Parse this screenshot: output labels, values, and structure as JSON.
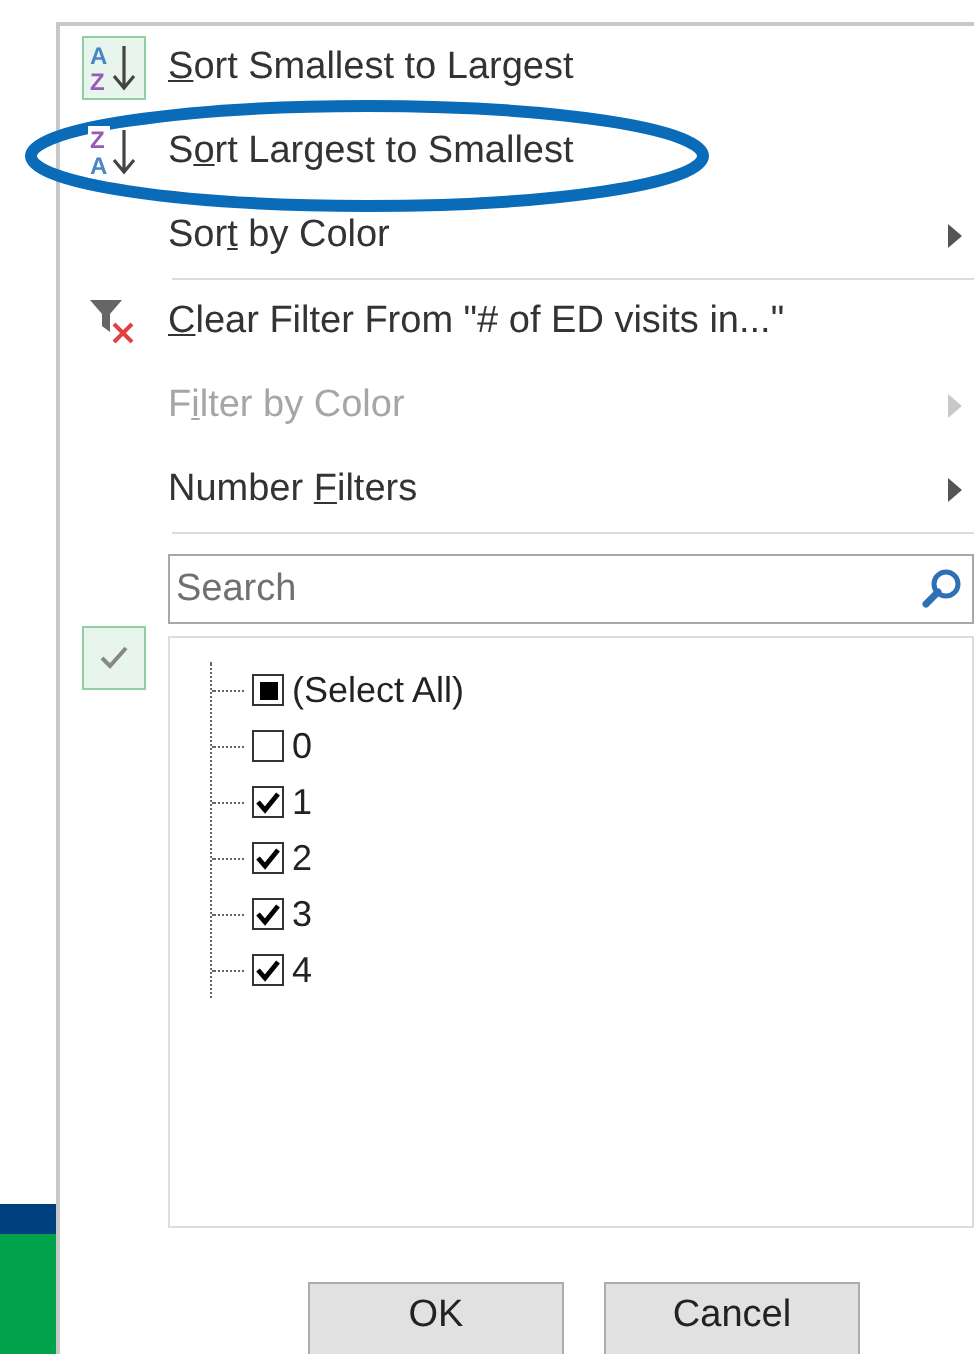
{
  "menu": {
    "items": [
      {
        "kind": "sort-asc",
        "icon_letters": [
          "A",
          "Z"
        ],
        "key": "S",
        "rest": "ort Smallest to Largest",
        "active": true,
        "highlighted": false,
        "disabled": false,
        "submenu": false,
        "divider_after": false
      },
      {
        "kind": "sort-desc",
        "icon_letters": [
          "Z",
          "A"
        ],
        "lead": "S",
        "key": "o",
        "rest": "rt Largest to Smallest",
        "active": false,
        "highlighted": true,
        "disabled": false,
        "submenu": false,
        "divider_after": false
      },
      {
        "kind": "plain",
        "lead": "Sor",
        "key": "t",
        "rest": " by Color",
        "active": false,
        "highlighted": false,
        "disabled": false,
        "submenu": true,
        "divider_after": true
      },
      {
        "kind": "clear-filter",
        "key": "C",
        "rest": "lear Filter From \"# of ED visits in...\"",
        "active": false,
        "highlighted": false,
        "disabled": false,
        "submenu": false,
        "divider_after": false
      },
      {
        "kind": "plain",
        "lead": "F",
        "key": "i",
        "rest": "lter by Color",
        "active": false,
        "highlighted": false,
        "disabled": true,
        "submenu": true,
        "divider_after": false
      },
      {
        "kind": "plain",
        "lead": "Number ",
        "key": "F",
        "rest": "ilters",
        "active": false,
        "highlighted": false,
        "disabled": false,
        "submenu": true,
        "divider_after": true
      }
    ]
  },
  "search": {
    "placeholder": "Search"
  },
  "values": [
    {
      "label": "(Select All)",
      "checked": true,
      "partial": true
    },
    {
      "label": "0",
      "checked": false,
      "partial": false
    },
    {
      "label": "1",
      "checked": true,
      "partial": false
    },
    {
      "label": "2",
      "checked": true,
      "partial": false
    },
    {
      "label": "3",
      "checked": true,
      "partial": false
    },
    {
      "label": "4",
      "checked": true,
      "partial": false
    }
  ],
  "buttons": [
    "OK",
    "Cancel"
  ]
}
